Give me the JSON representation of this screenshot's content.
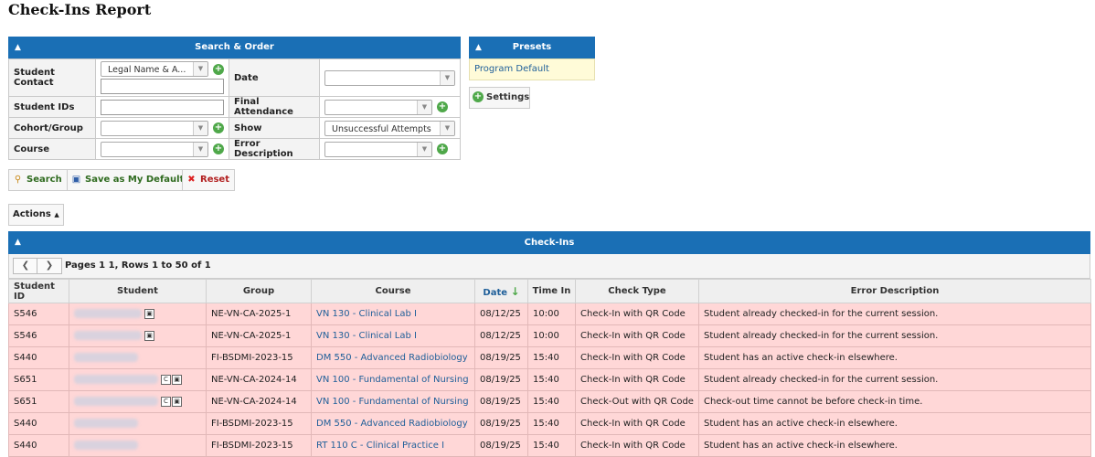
{
  "page": {
    "title": "Check-Ins Report"
  },
  "search_panel": {
    "header": "Search & Order",
    "fields": {
      "student_contact": {
        "label": "Student Contact",
        "select_value": "Legal Name & A...",
        "text_value": ""
      },
      "date": {
        "label": "Date",
        "value": ""
      },
      "student_ids": {
        "label": "Student IDs",
        "value": ""
      },
      "final_attendance": {
        "label": "Final Attendance",
        "value": ""
      },
      "cohort_group": {
        "label": "Cohort/Group",
        "value": ""
      },
      "show": {
        "label": "Show",
        "value": "Unsuccessful Attempts"
      },
      "course": {
        "label": "Course",
        "value": ""
      },
      "error_description": {
        "label": "Error Description",
        "value": ""
      }
    },
    "buttons": {
      "search": "Search",
      "save_default": "Save as My Default",
      "reset": "Reset"
    }
  },
  "presets": {
    "header": "Presets",
    "items": [
      "Program Default"
    ],
    "settings": "Settings"
  },
  "actions": {
    "label": "Actions"
  },
  "checkins": {
    "header": "Check-Ins",
    "pager": "Pages 1 1, Rows 1 to 50 of 1",
    "columns": [
      "Student ID",
      "Student",
      "Group",
      "Course",
      "Date",
      "Time In",
      "Check Type",
      "Error Description"
    ],
    "rows": [
      {
        "id": "S546",
        "group": "NE-VN-CA-2025-1",
        "course": "VN 130 - Clinical Lab I",
        "date": "08/12/25",
        "time": "10:00",
        "type": "Check-In with QR Code",
        "error": "Student already checked-in for the current session."
      },
      {
        "id": "S546",
        "group": "NE-VN-CA-2025-1",
        "course": "VN 130 - Clinical Lab I",
        "date": "08/12/25",
        "time": "10:00",
        "type": "Check-In with QR Code",
        "error": "Student already checked-in for the current session."
      },
      {
        "id": "S440",
        "group": "FI-BSDMI-2023-15",
        "course": "DM 550 - Advanced Radiobiology",
        "date": "08/19/25",
        "time": "15:40",
        "type": "Check-In with QR Code",
        "error": "Student has an active check-in elsewhere."
      },
      {
        "id": "S651",
        "group": "NE-VN-CA-2024-14",
        "course": "VN 100 - Fundamental of Nursing",
        "date": "08/19/25",
        "time": "15:40",
        "type": "Check-In with QR Code",
        "error": "Student already checked-in for the current session."
      },
      {
        "id": "S651",
        "group": "NE-VN-CA-2024-14",
        "course": "VN 100 - Fundamental of Nursing",
        "date": "08/19/25",
        "time": "15:40",
        "type": "Check-Out with QR Code",
        "error": "Check-out time cannot be before check-in time."
      },
      {
        "id": "S440",
        "group": "FI-BSDMI-2023-15",
        "course": "DM 550 - Advanced Radiobiology",
        "date": "08/19/25",
        "time": "15:40",
        "type": "Check-In with QR Code",
        "error": "Student has an active check-in elsewhere."
      },
      {
        "id": "S440",
        "group": "FI-BSDMI-2023-15",
        "course": "RT 110 C - Clinical Practice I",
        "date": "08/19/25",
        "time": "15:40",
        "type": "Check-In with QR Code",
        "error": "Student has an active check-in elsewhere."
      }
    ]
  }
}
